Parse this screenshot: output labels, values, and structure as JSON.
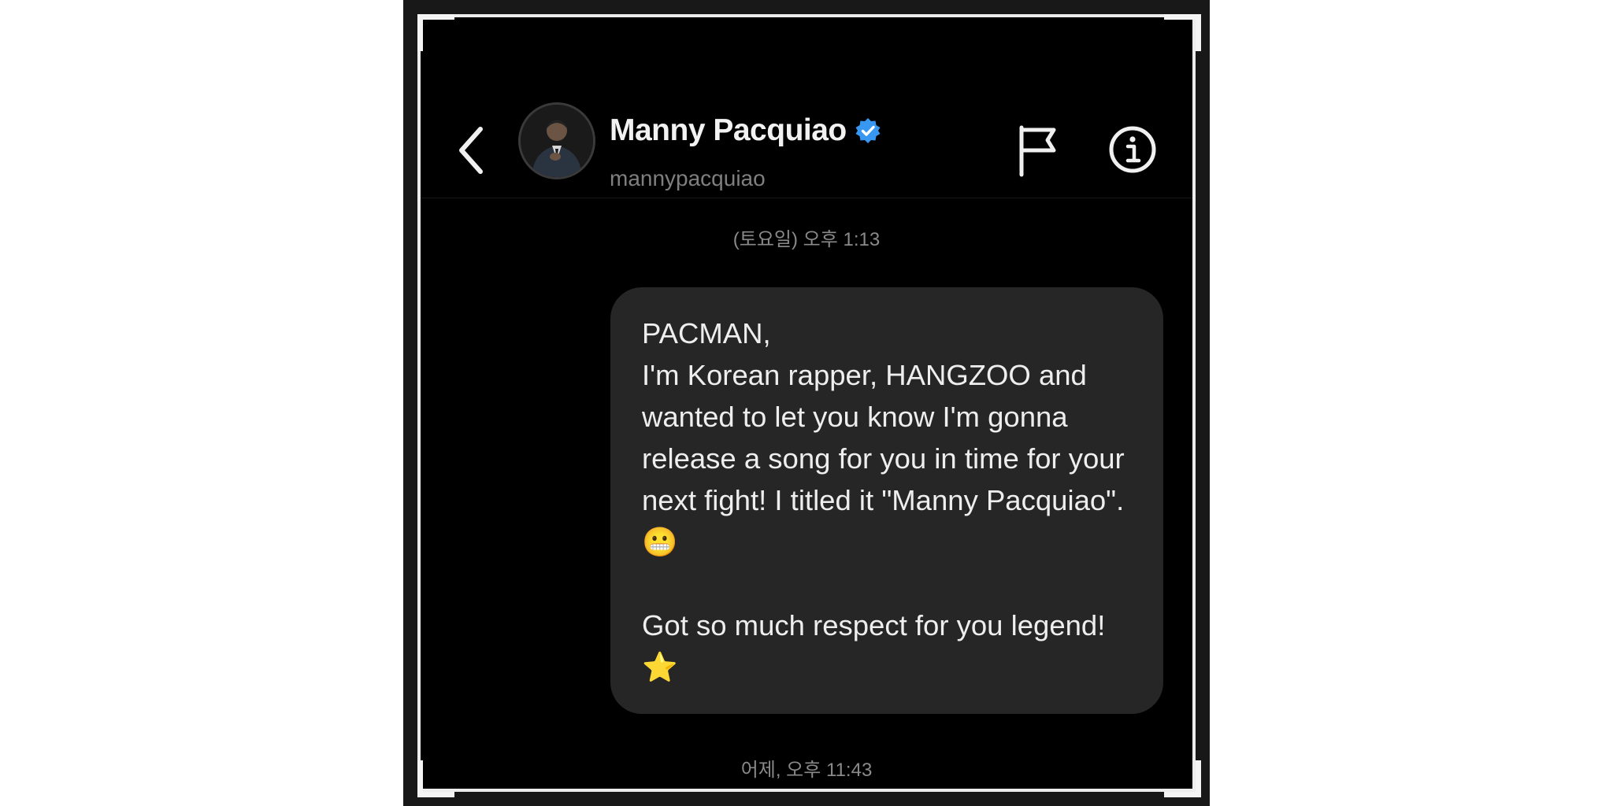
{
  "conversation": {
    "name": "Manny Pacquiao",
    "username": "mannypacquiao",
    "verified": true
  },
  "icons": {
    "back": "chevron-left-icon",
    "flag": "flag-icon",
    "info": "info-icon",
    "verified": "verified-badge-icon"
  },
  "colors": {
    "background": "#000000",
    "bubble": "#262626",
    "verified": "#3897f0"
  },
  "messages": [
    {
      "timestamp": "(토요일) 오후 1:13",
      "text": "PACMAN,\nI'm Korean rapper, HANGZOO and wanted to let you know I'm gonna release a song for you in time for your next fight! I titled it \"Manny Pacquiao\". 😬\n\nGot so much respect for you legend! ⭐"
    }
  ],
  "footer_timestamp": "어제, 오후 11:43"
}
